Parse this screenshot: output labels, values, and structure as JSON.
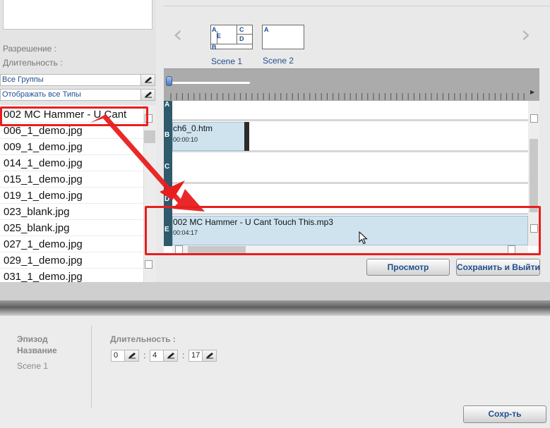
{
  "left_panel": {
    "resolution_label": "Разрешение :",
    "duration_label": "Длительность :",
    "group_filter": "Все Группы",
    "type_filter": "Отображать все Типы",
    "files": [
      "002 MC Hammer - U Cant",
      "006_1_demo.jpg",
      "009_1_demo.jpg",
      "014_1_demo.jpg",
      "015_1_demo.jpg",
      "019_1_demo.jpg",
      "023_blank.jpg",
      "025_blank.jpg",
      "027_1_demo.jpg",
      "029_1_demo.jpg",
      "031_1_demo.jpg"
    ]
  },
  "scenes": {
    "prev_icon": "chevron-left-icon",
    "next_icon": "chevron-right-icon",
    "items": [
      {
        "label": "Scene 1",
        "layout_letters": [
          "A",
          "C",
          "E",
          "D",
          "B"
        ]
      },
      {
        "label": "Scene 2",
        "layout_letters": [
          "A"
        ]
      }
    ]
  },
  "timeline": {
    "tracks": [
      "A",
      "B",
      "C",
      "D",
      "E"
    ],
    "clips": [
      {
        "track": "B",
        "title": "ch6_0.htm",
        "time": "00:00:10"
      },
      {
        "track": "E",
        "title": "002 MC Hammer - U Cant Touch This.mp3",
        "time": "00:04:17"
      }
    ],
    "preview_button": "Просмотр",
    "save_exit_button": "Сохранить и Выйти"
  },
  "bottom": {
    "episode_label": "Эпизод",
    "name_label": "Название",
    "name_value": "Scene 1",
    "duration_label": "Длительность :",
    "duration": {
      "hours": "0",
      "minutes": "4",
      "seconds": "17"
    },
    "separator": ":",
    "save_button": "Сохр-ть"
  },
  "colors": {
    "annotation_red": "#e81e1e",
    "link_blue": "#1f4f8f",
    "clip_fill": "#cfe3ef",
    "track_strip": "#2e5a6c"
  }
}
